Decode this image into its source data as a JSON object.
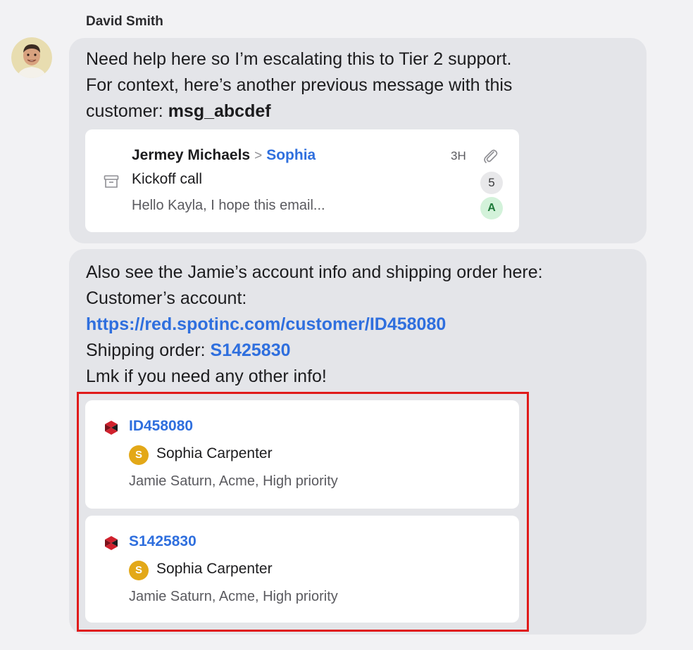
{
  "sender": {
    "name": "David Smith",
    "avatar_icon": "user-avatar-photo"
  },
  "message1": {
    "line1": "Need help here so I’m escalating this to Tier 2 support.",
    "line2": "For context, here’s another previous message with this",
    "line3_prefix": "customer: ",
    "line3_ref": "msg_abcdef",
    "email_preview": {
      "from": "Jermey Michaels",
      "separator": ">",
      "to": "Sophia",
      "time": "3H",
      "subject": "Kickoff call",
      "snippet": "Hello Kayla, I hope this email...",
      "count": "5",
      "assignee_initial": "A",
      "icons": [
        "archive-icon",
        "paperclip-icon"
      ]
    }
  },
  "message2": {
    "line1": "Also see the Jamie’s account info and shipping order here:",
    "line2": "Customer’s account:",
    "account_link": "https://red.spotinc.com/customer/ID458080",
    "line4_prefix": "Shipping order: ",
    "order_link": "S1425830",
    "line5": "Lmk if you need any other info!",
    "records": [
      {
        "id": "ID458080",
        "owner_initial": "S",
        "owner": "Sophia Carpenter",
        "meta": "Jamie Saturn, Acme, High priority",
        "icon": "spotinc-logo-icon"
      },
      {
        "id": "S1425830",
        "owner_initial": "S",
        "owner": "Sophia Carpenter",
        "meta": "Jamie Saturn, Acme, High priority",
        "icon": "spotinc-logo-icon"
      }
    ]
  },
  "colors": {
    "link": "#2f6fde",
    "bubble": "#e4e5e9",
    "highlight": "#e01b1b",
    "owner_avatar": "#e3a818",
    "assignee_badge": "#d3f2da"
  }
}
